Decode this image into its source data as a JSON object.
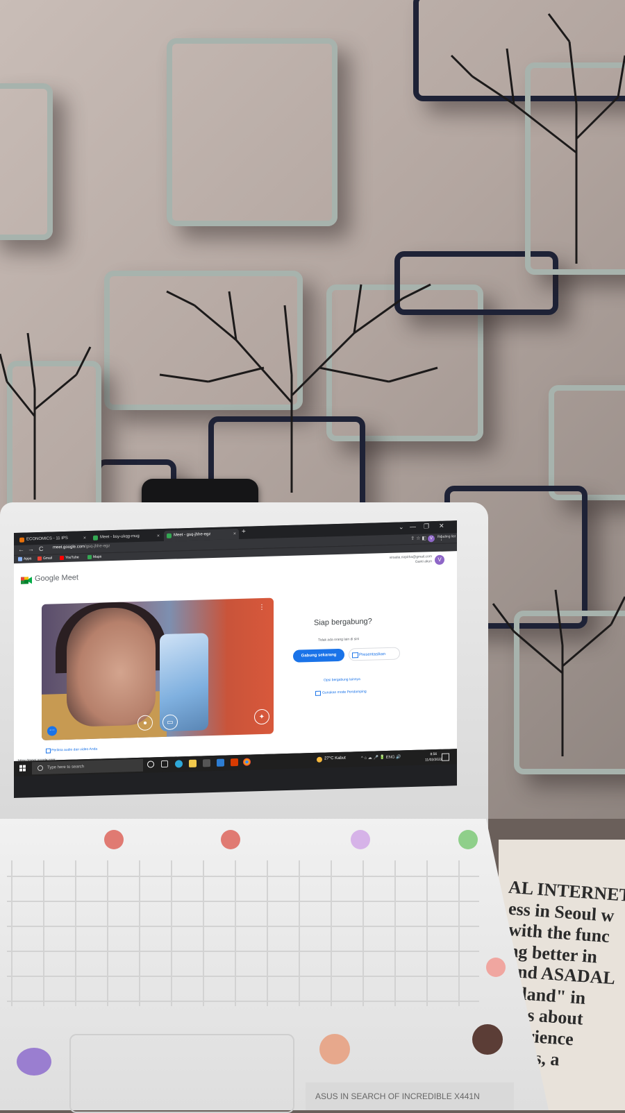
{
  "browser": {
    "tabs": [
      {
        "label": "ECONOMICS - 11 IPS",
        "favicon_color": "#e8710a"
      },
      {
        "label": "Meet - bsy-ukqg-mug",
        "favicon_color": "#34a853"
      },
      {
        "label": "Meet - gsq-jhhe-egz",
        "favicon_color": "#34a853"
      }
    ],
    "new_tab": "+",
    "window_controls": [
      "⌄",
      "—",
      "❐",
      "✕"
    ],
    "nav": {
      "back": "←",
      "forward": "→",
      "reload": "C"
    },
    "url_host": "meet.google.com",
    "url_path": "/gsq-jhhe-egz",
    "profile_initial": "V",
    "reading_list": "Reading list",
    "bookmarks": [
      {
        "label": "Apps",
        "color": "#8ab4f8"
      },
      {
        "label": "Gmail",
        "color": "#ea4335"
      },
      {
        "label": "YouTube",
        "color": "#ff0000"
      },
      {
        "label": "Maps",
        "color": "#34a853"
      }
    ]
  },
  "meet": {
    "brand": "Google Meet",
    "account_email": "virsalia.nirpitha@gmail.com",
    "switch_account": "Ganti akun",
    "avatar_initial": "V",
    "ready_title": "Siap bergabung?",
    "no_one_here": "Tidak ada orang lain di sini",
    "join_now": "Gabung sekarang",
    "present": "Presentasikan",
    "other_options": "Opsi bergabung lainnya",
    "companion_mode": "Gunakan mode Pendamping",
    "check_audio_video": "Periksa audio dan video Anda",
    "more_options": "⋮",
    "mic_icon": "microphone-icon",
    "camera_icon": "camera-icon",
    "effects_icon": "sparkle-icon",
    "status_url": "https://meet.google.com"
  },
  "taskbar": {
    "search_placeholder": "Type here to search",
    "weather": "27°C  Kabut",
    "time": "8:56",
    "date": "11/02/2022",
    "tray": "^  ⌂  ☁  🎤  🔋  ENG  🔊"
  },
  "hardware": {
    "brand_plate": "ASUS  IN SEARCH OF INCREDIBLE      X441N",
    "book_lines": [
      "AL INTERNET,",
      "ess in Seoul w",
      "with the func",
      "ng better in",
      "and ASADAL",
      "a land\" in",
      "has about",
      "perience",
      "hers, a"
    ]
  }
}
